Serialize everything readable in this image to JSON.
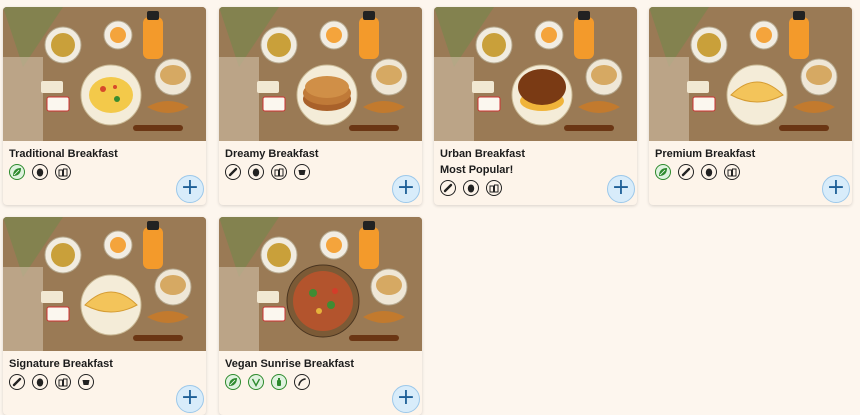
{
  "colors": {
    "accent": "#1d5f97",
    "green": "#2e8b2e",
    "background": "#fdf6ee"
  },
  "add_button": {
    "label": "+"
  },
  "cards": [
    {
      "title": "Traditional Breakfast",
      "subtitle": "",
      "plate": "scrambled-eggs",
      "icons": [
        "leaf-icon",
        "egg-icon",
        "milk-icon"
      ]
    },
    {
      "title": "Dreamy Breakfast",
      "subtitle": "",
      "plate": "pancakes",
      "icons": [
        "sausage-icon",
        "egg-icon",
        "milk-icon",
        "cup-icon"
      ]
    },
    {
      "title": "Urban Breakfast",
      "subtitle": "Most Popular!",
      "plate": "bagel-sandwich",
      "icons": [
        "sausage-icon",
        "egg-icon",
        "milk-icon"
      ]
    },
    {
      "title": "Premium Breakfast",
      "subtitle": "",
      "plate": "omelette",
      "icons": [
        "leaf-icon",
        "sausage-icon",
        "egg-icon",
        "milk-icon"
      ]
    },
    {
      "title": "Signature Breakfast",
      "subtitle": "",
      "plate": "omelette",
      "icons": [
        "sausage-icon",
        "egg-icon",
        "milk-icon",
        "cup-icon"
      ]
    },
    {
      "title": "Vegan Sunrise Breakfast",
      "subtitle": "",
      "plate": "vegan-bowl",
      "icons": [
        "leaf-icon",
        "vegan-v-icon",
        "bottle-icon",
        "chili-icon"
      ]
    }
  ]
}
